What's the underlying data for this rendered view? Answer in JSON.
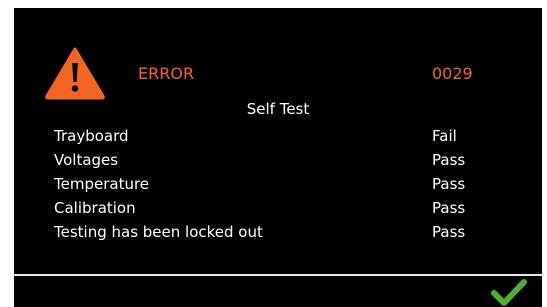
{
  "header": {
    "icon": "warning-triangle-icon",
    "error_label": "ERROR",
    "error_code": "0029"
  },
  "test": {
    "title": "Self Test",
    "results": [
      {
        "name": "Trayboard",
        "status": "Fail"
      },
      {
        "name": "Voltages",
        "status": "Pass"
      },
      {
        "name": "Temperature",
        "status": "Pass"
      },
      {
        "name": "Calibration",
        "status": "Pass"
      },
      {
        "name": "Testing has been locked out",
        "status": "Pass"
      }
    ]
  },
  "footer": {
    "confirm_icon": "checkmark-icon"
  },
  "colors": {
    "background": "#000000",
    "text": "#ffffff",
    "error_accent": "#f26522",
    "confirm_green": "#4caf32"
  }
}
